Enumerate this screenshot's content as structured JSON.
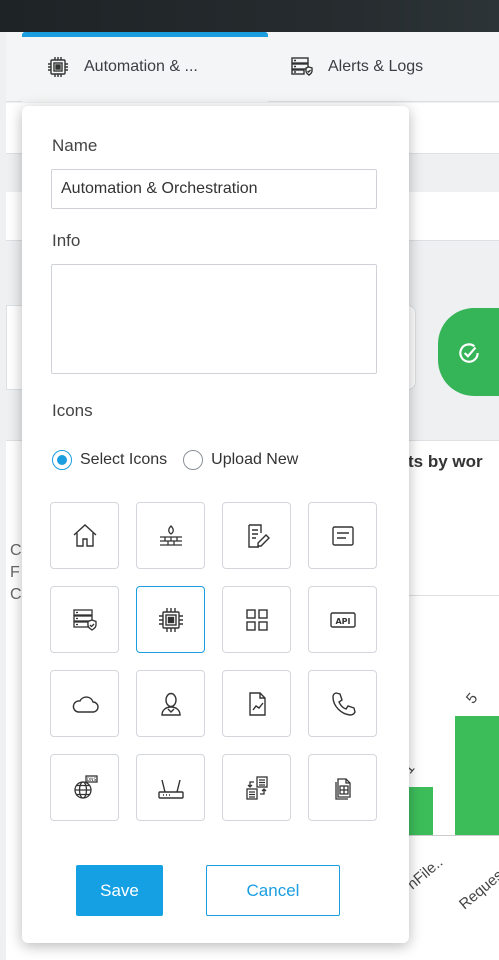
{
  "tabs": [
    {
      "label": "Automation & ...",
      "icon": "chip-icon",
      "active": true
    },
    {
      "label": "Alerts & Logs",
      "icon": "server-shield-icon",
      "active": false
    }
  ],
  "background": {
    "heading_fragment": "ts by wor",
    "left_letters": [
      "C",
      "F",
      "C"
    ],
    "chart": {
      "bar_value_labels": [
        "5",
        "1"
      ],
      "x_labels": [
        "nFile..",
        "Reques"
      ]
    }
  },
  "popup": {
    "name_label": "Name",
    "name_value": "Automation & Orchestration",
    "info_label": "Info",
    "info_value": "",
    "icons_label": "Icons",
    "radio_select": "Select Icons",
    "radio_upload": "Upload New",
    "selected_mode": "Select Icons",
    "icon_grid": [
      "home-icon",
      "firewall-icon",
      "edit-document-icon",
      "message-box-icon",
      "server-shield-icon",
      "chip-icon",
      "dashboard-grid-icon",
      "api-icon",
      "cloud-icon",
      "user-icon",
      "report-chart-icon",
      "phone-icon",
      "dns-globe-icon",
      "router-icon",
      "data-transfer-icon",
      "spreadsheet-doc-icon"
    ],
    "selected_icon": "chip-icon",
    "api_text": "API",
    "dns_text": "DNS",
    "save_label": "Save",
    "cancel_label": "Cancel"
  },
  "colors": {
    "accent": "#1a9ee0",
    "green": "#35b558"
  }
}
